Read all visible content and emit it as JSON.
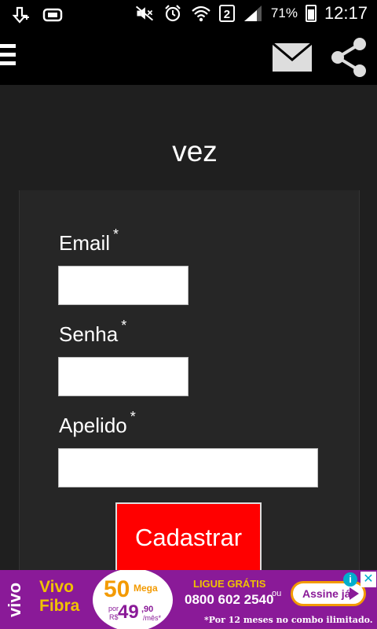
{
  "status_bar": {
    "battery_percent": "71%",
    "time": "12:17",
    "sim_slot": "2",
    "icons": [
      "usb-debug-icon",
      "sd-card-icon",
      "mute-icon",
      "alarm-icon",
      "wifi-icon",
      "sim-2-icon",
      "signal-icon",
      "battery-icon"
    ]
  },
  "toolbar": {
    "icons": [
      "menu-icon",
      "mail-icon",
      "share-icon"
    ]
  },
  "page": {
    "title": "vez"
  },
  "form": {
    "email_label": "Email",
    "password_label": "Senha",
    "nickname_label": "Apelido",
    "required_mark": "*",
    "email_value": "",
    "password_value": "",
    "nickname_value": "",
    "submit_label": "Cadastrar"
  },
  "ad": {
    "brand": "vivo",
    "product_line1": "Vivo",
    "product_line2": "Fibra",
    "speed": "50",
    "speed_unit": "Mega",
    "price_prefix_1": "por",
    "price_prefix_2": "R$",
    "price": "49",
    "price_cents": ",90",
    "price_period": "/mês*",
    "call_title": "LIGUE GRÁTIS",
    "phone": "0800 602 2540",
    "or": "ou",
    "cta_label": "Assine já",
    "note": "*Por 12 meses no combo ilimitado.",
    "info_label": "i",
    "close_label": "✕",
    "colors": {
      "background": "#8a1a98",
      "accent": "#f39a00",
      "yellow": "#f0c200",
      "info": "#00aecd"
    }
  },
  "colors": {
    "bar_background": "#000000",
    "page_background": "#1f1f1f",
    "card_background": "#262626",
    "submit_button": "#ff0000"
  }
}
